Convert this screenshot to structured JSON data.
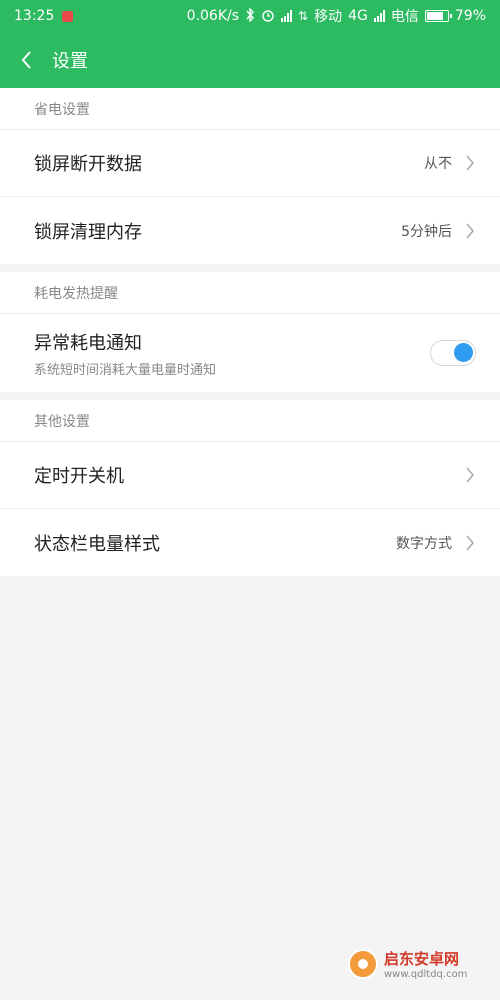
{
  "status_bar": {
    "time": "13:25",
    "speed": "0.06K/s",
    "carrier1": "移动",
    "network": "4G",
    "carrier2": "电信",
    "battery": "79%"
  },
  "app_bar": {
    "title": "设置"
  },
  "sections": [
    {
      "header": "省电设置",
      "items": [
        {
          "label": "锁屏断开数据",
          "value": "从不"
        },
        {
          "label": "锁屏清理内存",
          "value": "5分钟后"
        }
      ]
    },
    {
      "header": "耗电发热提醒",
      "items": [
        {
          "label": "异常耗电通知",
          "subtitle": "系统短时间消耗大量电量时通知",
          "toggle_on": true
        }
      ]
    },
    {
      "header": "其他设置",
      "items": [
        {
          "label": "定时开关机",
          "value": ""
        },
        {
          "label": "状态栏电量样式",
          "value": "数字方式"
        }
      ]
    }
  ],
  "watermark": {
    "name": "启东安卓网",
    "url": "www.qdltdq.com"
  },
  "colors": {
    "accent": "#2dbb62",
    "toggle_knob": "#2f9cf0"
  }
}
